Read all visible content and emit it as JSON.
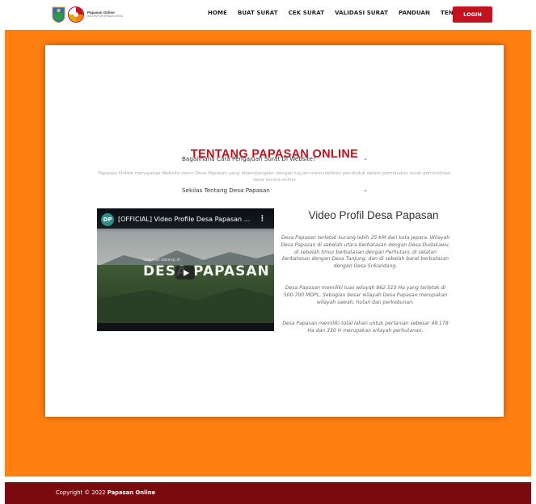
{
  "brand": {
    "name": "Papasan Online",
    "subtitle": "SISTEM INFORMASI DESA"
  },
  "nav": {
    "items": [
      "HOME",
      "BUAT SURAT",
      "CEK SURAT",
      "VALIDASI SURAT",
      "PANDUAN",
      "TENTANG"
    ],
    "login": "LOGIN"
  },
  "about": {
    "title": "TENTANG PAPASAN ONLINE",
    "description": "Papasan Online merupakan Website resmi Desa Papasan yang dikembangkan dengan tujuan memudahkan penduduk dalam pembuatan surat administrasi desa secara online",
    "accordion": [
      {
        "label": "Bagaimana Cara Pengajuan Surat Di Website?",
        "chevron": "⌄"
      },
      {
        "label": "Sekilas Tentang Desa Papasan",
        "chevron": "⌄"
      }
    ]
  },
  "video": {
    "channel_initial": "DP",
    "title": "[OFFICIAL] Video Profile Desa Papasan ...",
    "menu": "⋮",
    "overlay_small": "Selamat datang di",
    "overlay_big": "DESA PAPASAN"
  },
  "profile": {
    "title": "Video Profil Desa Papasan",
    "paragraphs": [
      "Desa Papasan terletak kurang lebih 25 KM dari kota Jepara. Wilayah Desa Papasan di sebelah utara berbatasan dengan Desa Dudakawu, di sebelah timur berbatasan dengan Perhutani, di selatan berbatasan dengan Desa Tanjung, dan di sebelah barat berbatasan dengan Desa Srikandang.",
      "Desa Papasan memiliki luas wilayah 862.510 Ha yang terletak di 500-700 MDPL. Sebagian besar wilayah Desa Papasan merupakan wilayah sawah, hutan dan perkebunan.",
      "Desa Papasan memiliki total lahan untuk pertanian sebesar 49.178 Ha dan 330 H merupakan wilayah perhutanan."
    ]
  },
  "footer": {
    "copyright_prefix": "Copyright © 2022 ",
    "copyright_brand": "Papasan Online"
  },
  "colors": {
    "accent": "#c1121f",
    "hero_bg": "#ff7f11",
    "footer_bg": "#7a0a0e"
  }
}
